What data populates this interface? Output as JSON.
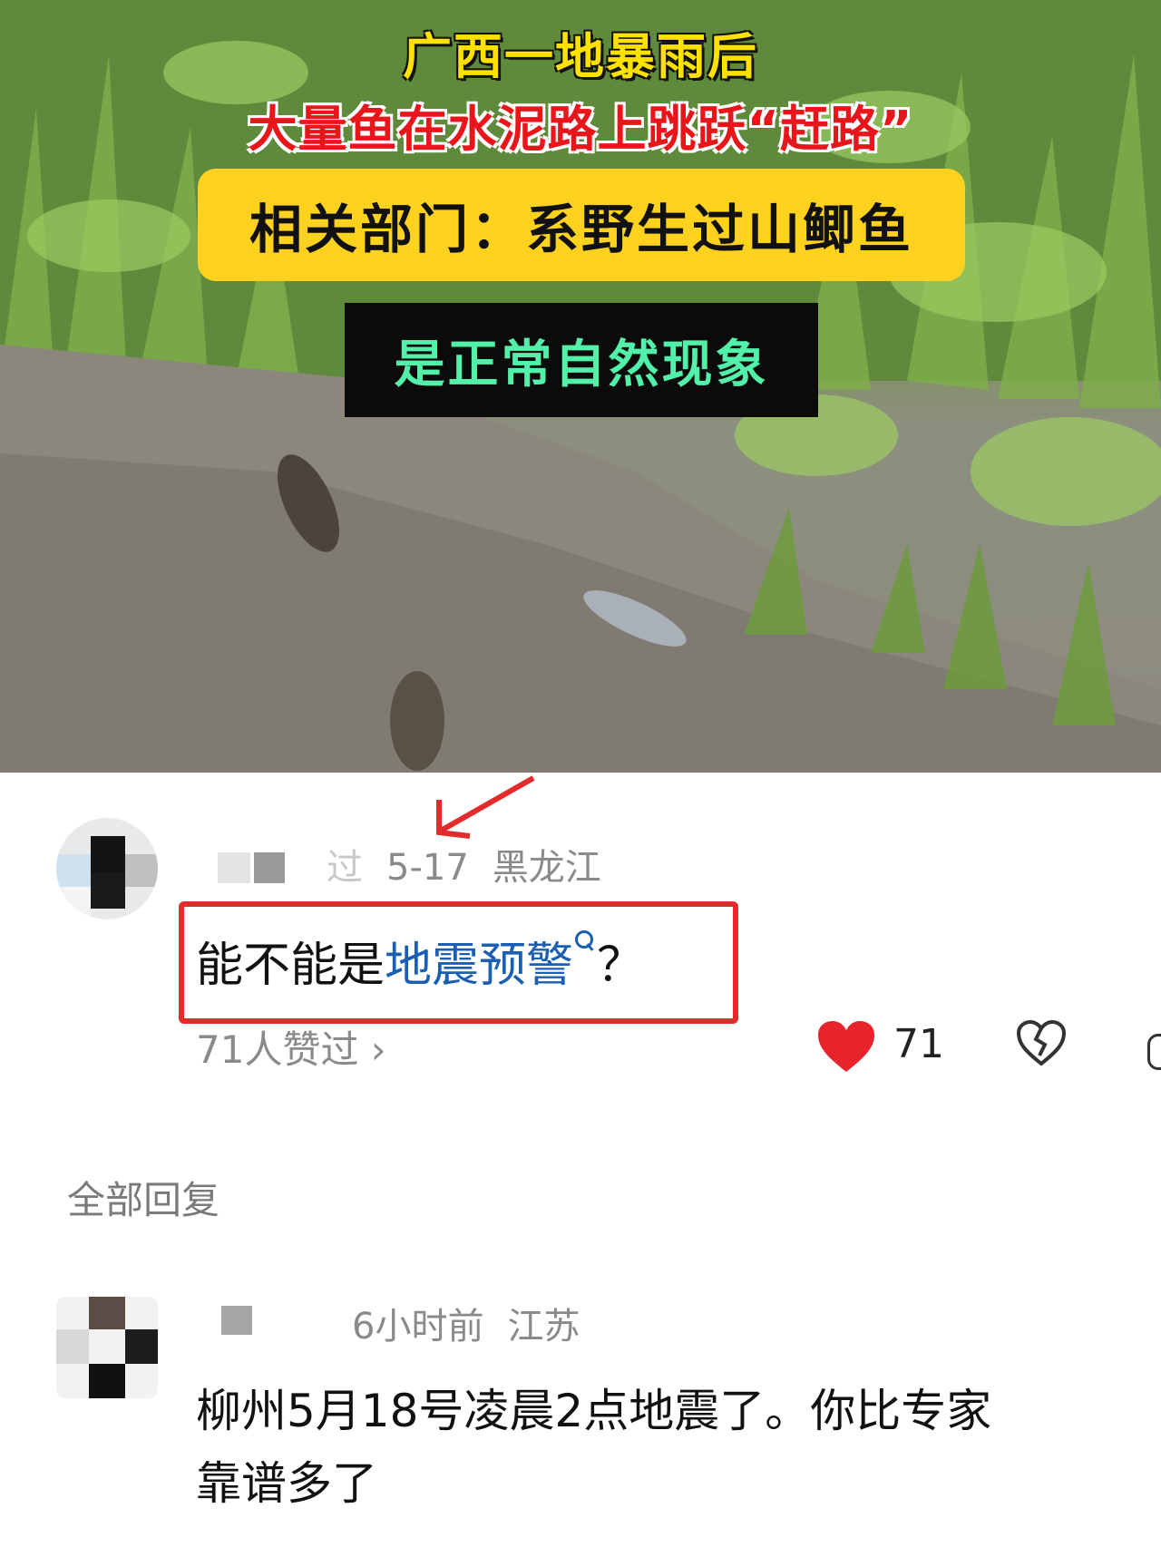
{
  "video": {
    "caption_line1": "广西一地暴雨后",
    "caption_line2": "大量鱼在水泥路上跳跃“赶路”",
    "caption_box1": "相关部门：系野生过山鲫鱼",
    "caption_box2": "是正常自然现象"
  },
  "comment": {
    "author_partial": "过",
    "date": "5-17",
    "location": "黑龙江",
    "text_prefix": "能不能是",
    "text_link": "地震预警",
    "text_suffix": "？",
    "likes_summary": "71人赞过 ›",
    "like_count": "71"
  },
  "section": {
    "all_replies_label": "全部回复"
  },
  "reply": {
    "time": "6小时前",
    "location": "江苏",
    "text_line1": "柳州5月18号凌晨2点地震了。你比专家",
    "text_line2": "靠谱多了"
  },
  "colors": {
    "link": "#1a5fb4",
    "highlight_border": "#e42b2b",
    "like_red": "#e8232b"
  },
  "icons": [
    "heart-icon",
    "broken-heart-icon",
    "search-icon",
    "chevron-right-icon"
  ]
}
